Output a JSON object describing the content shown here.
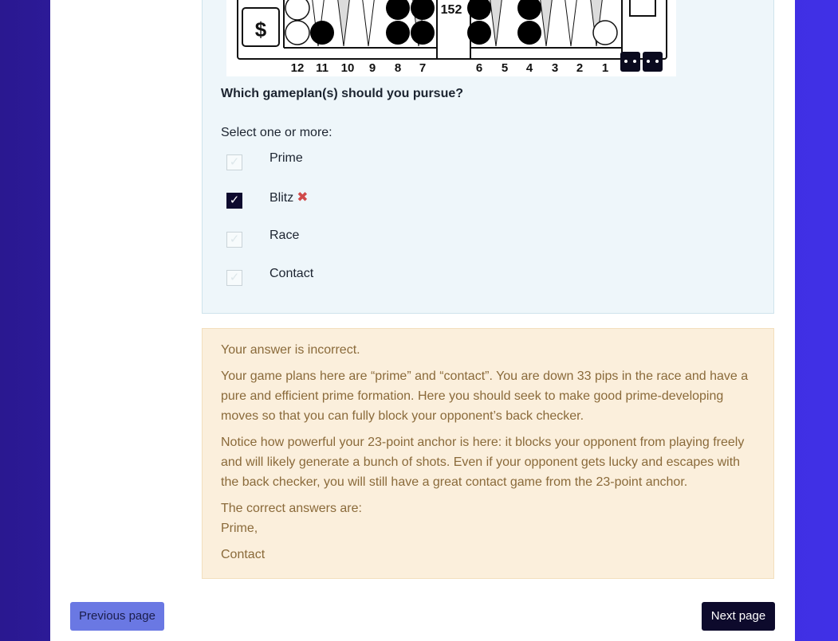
{
  "board": {
    "cube_symbol": "$",
    "pip_count": "152",
    "point_labels_left": [
      "12",
      "11",
      "10",
      "9",
      "8",
      "7"
    ],
    "point_labels_right": [
      "6",
      "5",
      "4",
      "3",
      "2",
      "1"
    ],
    "dice": [
      2,
      2
    ]
  },
  "question": {
    "text": "Which gameplan(s) should you pursue?",
    "prompt": "Select one or more:",
    "options": [
      {
        "label": "Prime",
        "checked": false,
        "mark": ""
      },
      {
        "label": "Blitz",
        "checked": true,
        "mark": "✖"
      },
      {
        "label": "Race",
        "checked": false,
        "mark": ""
      },
      {
        "label": "Contact",
        "checked": false,
        "mark": ""
      }
    ],
    "check_glyph": "✓"
  },
  "feedback": {
    "status": "Your answer is incorrect.",
    "paragraph1": "Your game plans here are “prime” and “contact”. You are down 33 pips in the race and have a pure and efficient prime formation. Here you should seek to make good prime-developing moves so that you can fully block your opponent’s back checker.",
    "paragraph2": "Notice how powerful your 23-point anchor is here: it blocks your opponent from playing freely and will likely generate a bunch of shots. Even if your opponent gets lucky and escapes with the back checker, you will still have a great contact game from the 23-point anchor.",
    "correct_intro": "The correct answers are:",
    "correct_1": "Prime,",
    "correct_2": "Contact"
  },
  "nav": {
    "previous": "Previous page",
    "next": "Next page"
  },
  "colors": {
    "background_left": "#2a1890",
    "background_right": "#4030e6",
    "question_panel": "#eef6fa",
    "feedback_panel": "#fbefdc",
    "feedback_text": "#8a6a3a",
    "checked_box": "#0e0a2e",
    "wrong_mark": "#d04a4a",
    "prev_button": "#6a78e3",
    "next_button": "#0d0a2c"
  }
}
